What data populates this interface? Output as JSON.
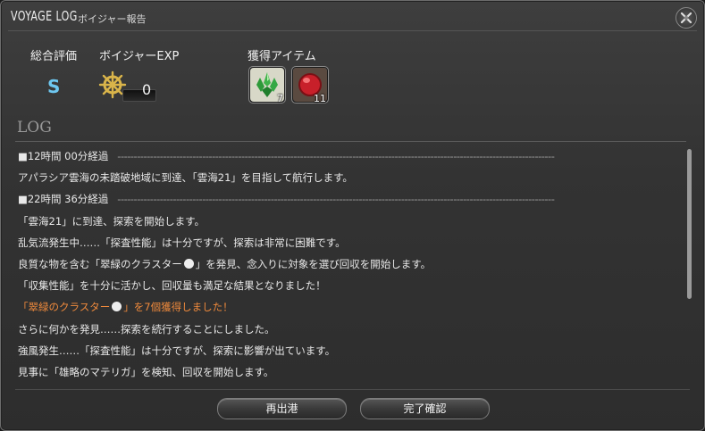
{
  "window": {
    "title": "VOYAGE LOG",
    "subtitle": "ボイジャー報告"
  },
  "summary": {
    "rating_label": "総合評価",
    "rating_value": "S",
    "exp_label": "ボイジャーEXP",
    "exp_value": "0",
    "items_label": "獲得アイテム",
    "items": [
      {
        "icon": "emerald-cluster-icon",
        "count": "7"
      },
      {
        "icon": "red-materia-icon",
        "count": "11"
      }
    ]
  },
  "log": {
    "heading": "LOG",
    "lines": [
      {
        "text": "■12時間 00分経過",
        "dashes": "--------------------------------------------------------------------------------------------------------------------------------------"
      },
      {
        "text": "アパラシア雲海の未踏破地域に到達、「雲海21」を目指して航行します。"
      },
      {
        "text": "■22時間 36分経過",
        "dashes": "--------------------------------------------------------------------------------------------------------------------------------------"
      },
      {
        "text": "「雲海21」に到達、探索を開始します。"
      },
      {
        "text": "乱気流発生中……「探査性能」は十分ですが、探索は非常に困難です。"
      },
      {
        "pre": "良質な物を含む「翠緑のクラスター",
        "post": "」を発見、念入りに対象を選び回収を開始します。"
      },
      {
        "text": "「収集性能」を十分に活かし、回収量も満足な結果となりました！"
      },
      {
        "pre": "「翠緑のクラスター",
        "post": "」を7個獲得しました！"
      },
      {
        "text": "さらに何かを発見……探索を続行することにしました。"
      },
      {
        "text": "強風発生……「探査性能」は十分ですが、探索に影響が出ています。"
      },
      {
        "text": "見事に「雄略のマテリガ」を検知、回収を開始します。"
      }
    ]
  },
  "buttons": {
    "redeploy": "再出港",
    "finalize": "完了確認"
  },
  "colors": {
    "rank": "#6ec7f0",
    "highlight": "#f08a3c"
  }
}
